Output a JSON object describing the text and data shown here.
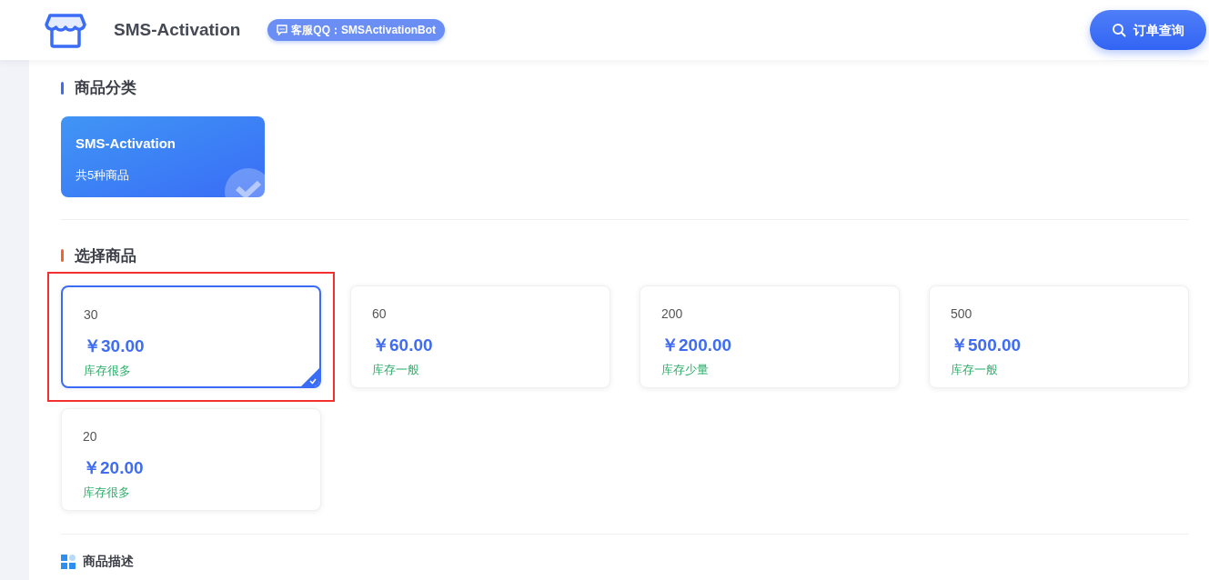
{
  "header": {
    "site_title": "SMS-Activation",
    "support_badge": "客服QQ：SMSActivationBot",
    "order_button": "订单查询"
  },
  "category_section": {
    "title": "商品分类",
    "color": "#3b6cf6",
    "categories": [
      {
        "name": "SMS-Activation",
        "count": "共5种商品",
        "selected": true
      }
    ]
  },
  "product_section": {
    "title": "选择商品",
    "color": "#f0642d",
    "products": [
      {
        "name": "30",
        "price": "￥30.00",
        "stock": "库存很多",
        "selected": true,
        "highlighted": true
      },
      {
        "name": "60",
        "price": "￥60.00",
        "stock": "库存一般",
        "selected": false,
        "highlighted": false
      },
      {
        "name": "200",
        "price": "￥200.00",
        "stock": "库存少量",
        "selected": false,
        "highlighted": false
      },
      {
        "name": "500",
        "price": "￥500.00",
        "stock": "库存一般",
        "selected": false,
        "highlighted": false
      },
      {
        "name": "20",
        "price": "￥20.00",
        "stock": "库存很多",
        "selected": false,
        "highlighted": false
      }
    ]
  },
  "description_section": {
    "title": "商品描述"
  }
}
